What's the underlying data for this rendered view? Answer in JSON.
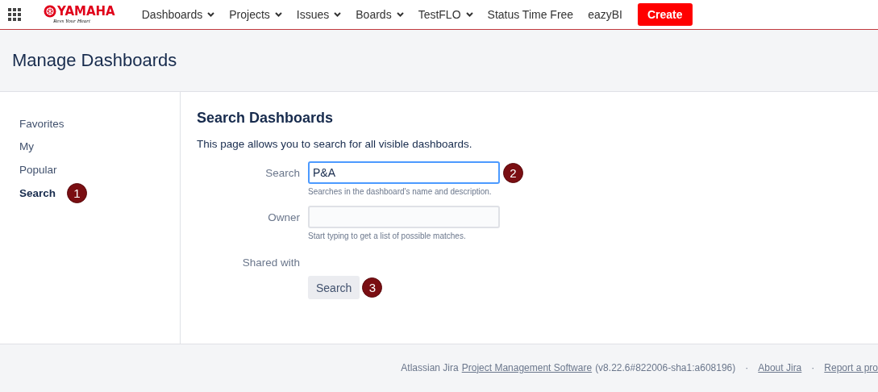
{
  "header": {
    "logo": {
      "name": "YAMAHA",
      "tagline": "Revs Your Heart"
    },
    "nav": [
      {
        "label": "Dashboards",
        "dropdown": true
      },
      {
        "label": "Projects",
        "dropdown": true
      },
      {
        "label": "Issues",
        "dropdown": true
      },
      {
        "label": "Boards",
        "dropdown": true
      },
      {
        "label": "TestFLO",
        "dropdown": true
      },
      {
        "label": "Status Time Free",
        "dropdown": false
      },
      {
        "label": "eazyBI",
        "dropdown": false
      }
    ],
    "create_button": "Create"
  },
  "page_title": "Manage Dashboards",
  "sidebar": {
    "items": [
      {
        "label": "Favorites",
        "selected": false
      },
      {
        "label": "My",
        "selected": false
      },
      {
        "label": "Popular",
        "selected": false
      },
      {
        "label": "Search",
        "selected": true,
        "step": "1"
      }
    ]
  },
  "content": {
    "heading": "Search Dashboards",
    "intro": "This page allows you to search for all visible dashboards.",
    "fields": [
      {
        "kind": "input",
        "label": "Search",
        "value": "P&A",
        "focused": true,
        "hint": "Searches in the dashboard's name and description.",
        "step": "2"
      },
      {
        "kind": "input",
        "label": "Owner",
        "focused": false,
        "hint": "Start typing to get a list of possible matches."
      },
      {
        "kind": "label",
        "label": "Shared with"
      }
    ],
    "search_button": "Search",
    "button_step": "3"
  },
  "footer": {
    "prefix": "Atlassian Jira",
    "product_link": "Project Management Software",
    "version": "(v8.22.6#822006-sha1:a608196)",
    "separator_1": "·",
    "about_link": "About Jira",
    "separator_2": "·",
    "report_link": "Report a pro"
  }
}
